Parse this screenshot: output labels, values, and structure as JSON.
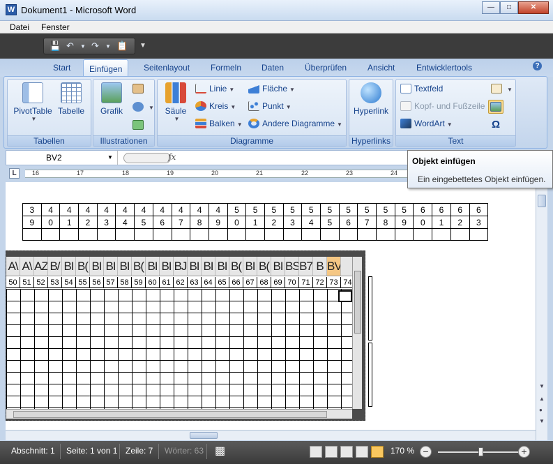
{
  "window": {
    "title": "Dokument1 - Microsoft Word",
    "app_icon": "W"
  },
  "menubar": [
    "Datei",
    "Fenster"
  ],
  "tabs": [
    "Start",
    "Einfügen",
    "Seitenlayout",
    "Formeln",
    "Daten",
    "Überprüfen",
    "Ansicht",
    "Entwicklertools"
  ],
  "active_tab": "Einfügen",
  "ribbon": {
    "tabellen": {
      "label": "Tabellen",
      "pivot": "PivotTable",
      "tabelle": "Tabelle"
    },
    "illustrationen": {
      "label": "Illustrationen",
      "grafik": "Grafik"
    },
    "diagramme": {
      "label": "Diagramme",
      "saeule": "Säule",
      "linie": "Linie",
      "kreis": "Kreis",
      "balken": "Balken",
      "flaeche": "Fläche",
      "punkt": "Punkt",
      "andere": "Andere Diagramme"
    },
    "hyperlinks": {
      "label": "Hyperlinks",
      "hyperlink": "Hyperlink"
    },
    "text": {
      "label": "Text",
      "textfeld": "Textfeld",
      "kopf": "Kopf- und Fußzeile",
      "wordart": "WordArt",
      "omega": "Ω"
    }
  },
  "formula": {
    "namebox": "BV2",
    "fx": "fx"
  },
  "ruler": [
    "16",
    "17",
    "18",
    "19",
    "20",
    "21",
    "22",
    "23",
    "24"
  ],
  "numtable": {
    "row1": [
      "3",
      "4",
      "4",
      "4",
      "4",
      "4",
      "4",
      "4",
      "4",
      "4",
      "4",
      "5",
      "5",
      "5",
      "5",
      "5",
      "5",
      "5",
      "5",
      "5",
      "5",
      "6",
      "6",
      "6",
      "6"
    ],
    "row2": [
      "9",
      "0",
      "1",
      "2",
      "3",
      "4",
      "5",
      "6",
      "7",
      "8",
      "9",
      "0",
      "1",
      "2",
      "3",
      "4",
      "5",
      "6",
      "7",
      "8",
      "9",
      "0",
      "1",
      "2",
      "3"
    ]
  },
  "embedded_sheet": {
    "col_headers": [
      "A\\",
      "A\\",
      "AZ",
      "B/",
      "BI",
      "B(",
      "BI",
      "BI",
      "BI",
      "B(",
      "BI",
      "BI",
      "BJ",
      "BI",
      "BI",
      "BI",
      "B(",
      "BI",
      "B(",
      "BI",
      "BS",
      "B7",
      "B",
      "BV"
    ],
    "row_numbers": [
      "50",
      "51",
      "52",
      "53",
      "54",
      "55",
      "56",
      "57",
      "58",
      "59",
      "60",
      "61",
      "62",
      "63",
      "64",
      "65",
      "66",
      "67",
      "68",
      "69",
      "70",
      "71",
      "72",
      "73",
      "74"
    ]
  },
  "tooltip": {
    "title": "Objekt einfügen",
    "body": "Ein eingebettetes Objekt einfügen."
  },
  "statusbar": {
    "abschnitt": "Abschnitt: 1",
    "seite": "Seite: 1 von 1",
    "zeile": "Zeile: 7",
    "woerter": "Wörter: 63",
    "zoom": "170 %"
  },
  "colors": {
    "accent": "#15428b",
    "selected_col": "#f5c784",
    "statusbar": "#3a3a3a"
  }
}
